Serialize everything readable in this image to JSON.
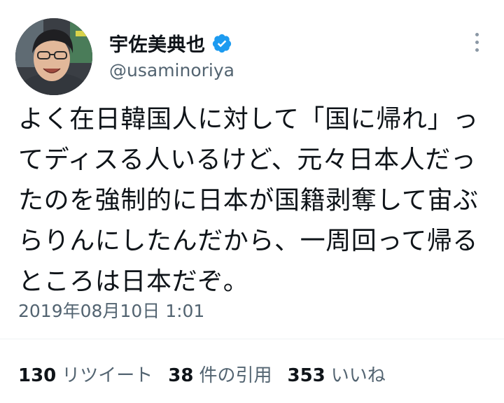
{
  "user": {
    "display_name": "宇佐美典也",
    "handle": "@usaminoriya",
    "verified": true
  },
  "tweet": {
    "lines": [
      "よく在日韓国人に対して「国に帰れ」っ",
      "てディスる人いるけど、元々日本人だっ",
      "たのを強制的に日本が国籍剥奪して宙ぶ",
      "らりんにしたんだから、一周回って帰る",
      "ところは日本だぞ。"
    ],
    "timestamp": "2019年08月10日 1:01"
  },
  "stats": {
    "retweets": {
      "count": "130",
      "label": "リツイート"
    },
    "quotes": {
      "count": "38",
      "label": "件の引用"
    },
    "likes": {
      "count": "353",
      "label": "いいね"
    }
  },
  "colors": {
    "verified": "#1d9bf0",
    "secondary_text": "#536471",
    "primary_text": "#0f1419"
  },
  "icons": {
    "verified": "verified-badge-icon",
    "more": "more-options-icon"
  }
}
